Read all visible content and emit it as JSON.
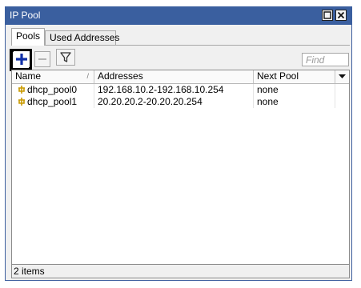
{
  "window": {
    "title": "IP Pool",
    "restore_icon": "restore-icon",
    "close_icon": "close-icon",
    "titlebar_color": "#3a5f9f"
  },
  "tabs": [
    {
      "label": "Pools",
      "active": true
    },
    {
      "label": "Used Addresses",
      "active": false
    }
  ],
  "toolbar": {
    "add_icon": "plus-icon",
    "remove_icon": "minus-icon",
    "filter_icon": "filter-icon",
    "find_placeholder": "Find"
  },
  "table": {
    "columns": [
      "Name",
      "Addresses",
      "Next Pool"
    ],
    "sort_indicator": "/",
    "rows": [
      {
        "name": "dhcp_pool0",
        "addresses": "192.168.10.2-192.168.10.254",
        "next_pool": "none"
      },
      {
        "name": "dhcp_pool1",
        "addresses": "20.20.20.2-20.20.20.254",
        "next_pool": "none"
      }
    ]
  },
  "status": {
    "item_count": "2 items"
  }
}
